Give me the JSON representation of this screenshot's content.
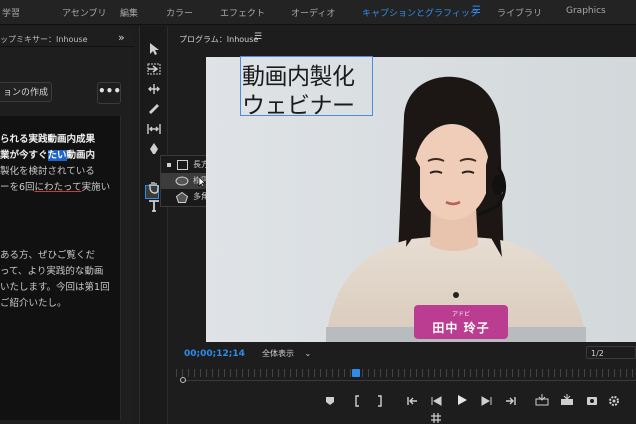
{
  "workspaces": [
    "学習",
    "アセンブリ",
    "編集",
    "カラー",
    "エフェクト",
    "オーディオ",
    "キャプションとグラフィック",
    "ライブラリ",
    "Graphics"
  ],
  "active_workspace": "キャプションとグラフィック",
  "workspace_menu_icon": "☰",
  "left_panel": {
    "header": "ップミキサー：Inhouse",
    "expand_icon": "»",
    "create_button": "ョンの作成",
    "more_button": "•••",
    "lines": [
      {
        "segments": [
          {
            "t": "られる実践動画内成果"
          }
        ],
        "style": "b"
      },
      {
        "segments": [
          {
            "t": "業が今すぐ"
          },
          {
            "t": "たい",
            "hl": true
          },
          {
            "t": "動画内"
          }
        ],
        "style": "b"
      },
      {
        "segments": [
          {
            "t": "製化を検討されている"
          }
        ],
        "style": "n"
      },
      {
        "segments": [
          {
            "t": "ーを6回"
          },
          {
            "t": "にわたって",
            "ul": true
          },
          {
            "t": "実施い"
          }
        ],
        "style": "n"
      },
      {
        "segments": [
          {
            "t": ""
          }
        ],
        "style": "n"
      },
      {
        "segments": [
          {
            "t": ""
          }
        ],
        "style": "n"
      },
      {
        "segments": [
          {
            "t": "ある方、ぜひご覧くだ"
          }
        ],
        "style": "n"
      },
      {
        "segments": [
          {
            "t": "って、より実践的な動画"
          }
        ],
        "style": "n"
      },
      {
        "segments": [
          {
            "t": "いたします。今回は第1回"
          }
        ],
        "style": "n"
      },
      {
        "segments": [
          {
            "t": "ご紹介いたし。"
          }
        ],
        "style": "n"
      }
    ]
  },
  "tools": [
    "selection-tool",
    "track-select-tool",
    "ripple-edit-tool",
    "razor-tool",
    "slip-tool",
    "pen-tool",
    "rectangle-tool",
    "hand-tool",
    "type-tool"
  ],
  "shape_popup": {
    "items": [
      {
        "label": "長方形ツール",
        "icon": "rectangle",
        "selected": false
      },
      {
        "label": "楕円ツール",
        "icon": "ellipse",
        "selected": true
      },
      {
        "label": "多角形ツール",
        "icon": "polygon",
        "selected": false
      }
    ]
  },
  "program_monitor": {
    "title": "プログラム：Inhouse",
    "menu_icon": "☰",
    "title_text_lines": [
      "動画内製化",
      "ウェビナー"
    ],
    "lower_third": {
      "role": "アドビ",
      "name": "田中 玲子"
    },
    "timecode": "00;00;12;14",
    "zoom": "全体表示",
    "zoom_arrow": "⌄",
    "resolution": "1/2",
    "playhead_fraction": 0.38
  },
  "transport_icons": [
    "marker-icon",
    "mark-in-icon",
    "mark-out-icon",
    "go-to-in-icon",
    "step-back-icon",
    "play-icon",
    "step-forward-icon",
    "go-to-out-icon",
    "insert-icon",
    "overwrite-icon",
    "export-frame-icon",
    "settings-icon",
    "safe-margins-icon"
  ],
  "colors": {
    "accent": "#2d8ceb",
    "lower_third": "#bb3d91",
    "selection": "#4a8de0"
  }
}
